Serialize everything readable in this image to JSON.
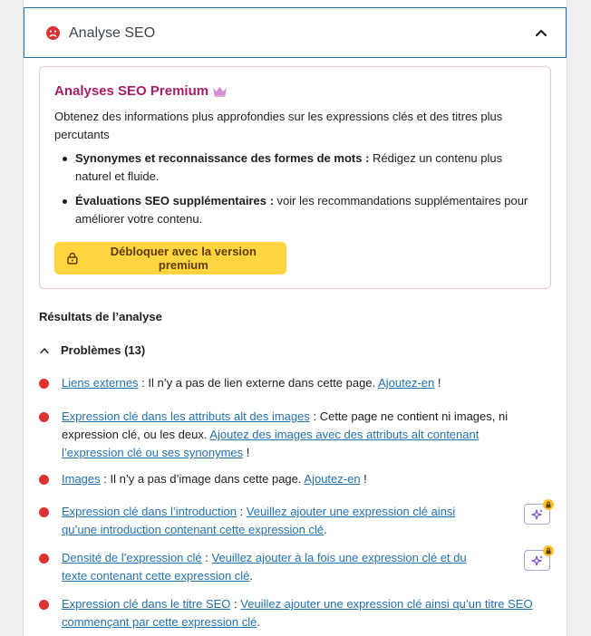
{
  "header": {
    "title": "Analyse SEO",
    "status_icon": "sad-face-icon",
    "toggle_icon": "chevron-up-icon"
  },
  "premium": {
    "title": "Analyses SEO Premium",
    "description": "Obtenez des informations plus approfondies sur les expressions clés et des titres plus percutants",
    "items": [
      {
        "bold": "Synonymes et reconnaissance des formes de mots :",
        "text": " Rédigez un contenu plus naturel et fluide."
      },
      {
        "bold": "Évaluations SEO supplémentaires :",
        "text": " voir les recommandations supplémentaires pour améliorer votre contenu."
      }
    ],
    "unlock_label": "Débloquer avec la version premium",
    "accent": "#a61e69",
    "button_color": "#fed441"
  },
  "results": {
    "heading": "Résultats de l’analyse",
    "problems_label": "Problèmes (13)",
    "bullet_color": "#dc3232",
    "items": [
      {
        "link": "Liens externes",
        "text": " : Il n’y a pas de lien externe dans cette page. ",
        "action": "Ajoutez-en",
        "end": " !"
      },
      {
        "link": "Expression clé dans les attributs alt des images",
        "text": " : Cette page ne contient ni images, ni expression clé, ou les deux. ",
        "action": "Ajoutez des images avec des attributs alt contenant l’expression clé ou ses synonymes",
        "end": " !"
      },
      {
        "link": "Images",
        "text": " : Il n’y a pas d’image dans cette page. ",
        "action": "Ajoutez-en",
        "end": " !"
      },
      {
        "link": "Expression clé dans l’introduction",
        "text": " : ",
        "action": "Veuillez ajouter une expression clé ainsi qu’une introduction contenant cette expression clé",
        "end": "."
      },
      {
        "link": "Densité de l’expression clé",
        "text": " : ",
        "action": "Veuillez ajouter à la fois une expression clé et du texte contenant cette expression clé",
        "end": "."
      },
      {
        "link": "Expression clé dans le titre SEO",
        "text": " : ",
        "action": "Veuillez ajouter une expression clé ainsi qu’un titre SEO commençant par cette expression clé",
        "end": "."
      }
    ]
  }
}
